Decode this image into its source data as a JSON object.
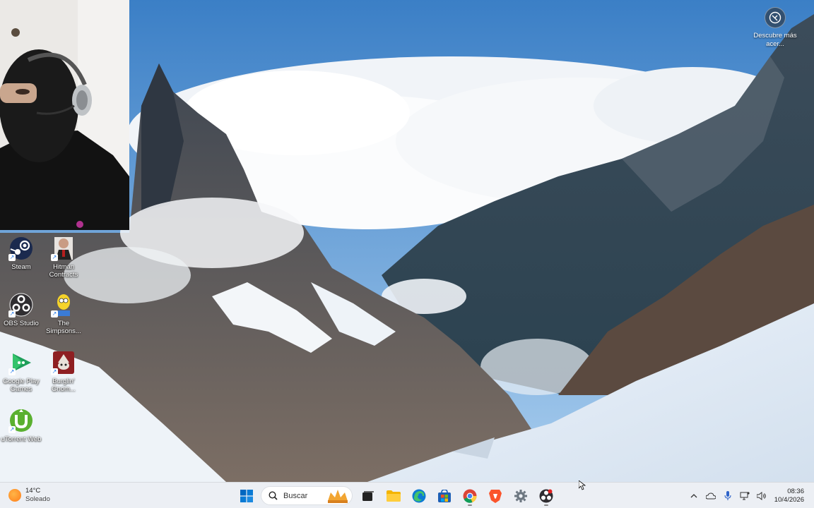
{
  "desktop": {
    "icons": [
      {
        "label": "Steam",
        "icon": "steam-icon"
      },
      {
        "label": "Hitman Contracts",
        "icon": "hitman-icon"
      },
      {
        "label": "OBS Studio",
        "icon": "obs-icon"
      },
      {
        "label": "The Simpsons...",
        "icon": "simpsons-icon"
      },
      {
        "label": "Google Play Games",
        "icon": "google-play-games-icon"
      },
      {
        "label": "Burglin' Gnom...",
        "icon": "burglin-gnomes-icon"
      },
      {
        "label": "uTorrent Web",
        "icon": "utorrent-icon"
      }
    ],
    "spotlight": {
      "label": "Descubre más acer...",
      "icon": "camera-icon"
    }
  },
  "taskbar": {
    "weather": {
      "temp": "14°C",
      "condition": "Soleado",
      "icon": "sun-icon"
    },
    "search_placeholder": "Buscar",
    "apps": [
      {
        "name": "start",
        "icon": "windows-start-icon"
      },
      {
        "name": "task-view",
        "icon": "task-view-icon"
      },
      {
        "name": "file-explorer",
        "icon": "folder-icon"
      },
      {
        "name": "edge",
        "icon": "edge-icon"
      },
      {
        "name": "store",
        "icon": "store-icon"
      },
      {
        "name": "chrome",
        "icon": "chrome-icon"
      },
      {
        "name": "brave",
        "icon": "brave-icon"
      },
      {
        "name": "settings",
        "icon": "gear-icon"
      },
      {
        "name": "obs",
        "icon": "obs-icon"
      }
    ],
    "tray": {
      "time": "08:36",
      "date": "10/4/2026"
    }
  },
  "colors": {
    "taskbar_bg": "#eceff4",
    "accent": "#0067c0",
    "sky_top": "#3f82c8"
  }
}
